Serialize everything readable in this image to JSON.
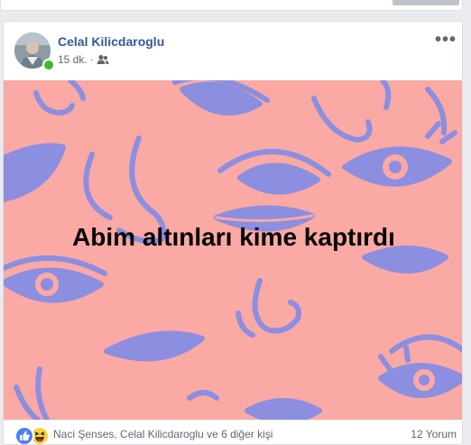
{
  "post": {
    "author": "Celal Kilicdaroglu",
    "time": "15 dk.",
    "separator": "·",
    "audience_icon": "friends-icon",
    "more_icon": "more-options-icon",
    "more_glyph": "•••",
    "image_text": "Abim altınları kime kaptırdı",
    "image_background": "#fba9a4",
    "pattern_color": "#8c8ee0"
  },
  "footer": {
    "reaction_icons": [
      "like-reaction-icon",
      "haha-reaction-icon"
    ],
    "reacted_by": "Naci Şenses, Celal Kilicdaroglu ve 6 diğer kişi",
    "comments": "12 Yorum"
  },
  "colors": {
    "link": "#365899",
    "online": "#42b72a",
    "like_blue": "#4a80f3",
    "haha_yellow": "#f7d23a"
  }
}
